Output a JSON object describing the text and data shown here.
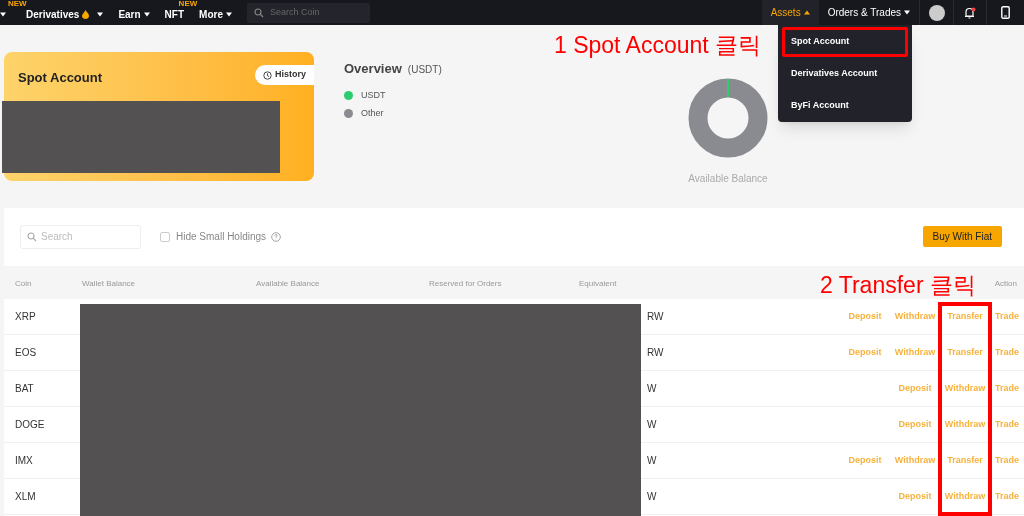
{
  "nav": {
    "items": [
      {
        "kind": "caret"
      },
      {
        "label": "Derivatives",
        "kind": "fire",
        "badge": "NEW"
      },
      {
        "label": "Earn",
        "kind": "menu"
      },
      {
        "label": "NFT",
        "kind": "plain",
        "badge": "NEW"
      },
      {
        "label": "More",
        "kind": "menu"
      }
    ],
    "search": {
      "placeholder": "Search Coin"
    },
    "right_items": [
      {
        "label": "Assets",
        "selected": true
      },
      {
        "label": "Orders & Trades",
        "selected": false
      }
    ]
  },
  "assets_menu": {
    "items": [
      {
        "label": "Spot Account",
        "annotated": true
      },
      {
        "label": "Derivatives Account",
        "annotated": false
      },
      {
        "label": "ByFi Account",
        "annotated": false
      }
    ]
  },
  "annotations": [
    "1 Spot Account 클릭",
    "2 Transfer 클릭"
  ],
  "account_card": {
    "title": "Spot Account",
    "history_button": "History"
  },
  "overview": {
    "title": "Overview",
    "unit": "(USDT)",
    "legend": [
      {
        "label": "USDT",
        "color": "#2ecc71"
      },
      {
        "label": "Other",
        "color": "#8a8b90"
      }
    ],
    "caption": "Available Balance"
  },
  "toolbar": {
    "search_placeholder": "Search",
    "hide_small": {
      "label": "Hide Small Holdings",
      "checked": false
    },
    "buy_button": "Buy With Fiat"
  },
  "table": {
    "columns": [
      "Coin",
      "Wallet Balance",
      "Available Balance",
      "Reserved for Orders",
      "Equivalent",
      "Action"
    ],
    "rows": [
      {
        "coin": "XRP",
        "equivalent": "RW",
        "actions": [
          "Deposit",
          "Withdraw",
          "Transfer",
          "Trade"
        ]
      },
      {
        "coin": "EOS",
        "equivalent": "RW",
        "actions": [
          "Deposit",
          "Withdraw",
          "Transfer",
          "Trade"
        ]
      },
      {
        "coin": "BAT",
        "equivalent": "W",
        "actions": [
          "Deposit",
          "Withdraw",
          "Trade"
        ]
      },
      {
        "coin": "DOGE",
        "equivalent": "W",
        "actions": [
          "Deposit",
          "Withdraw",
          "Trade"
        ]
      },
      {
        "coin": "IMX",
        "equivalent": "W",
        "actions": [
          "Deposit",
          "Withdraw",
          "Transfer",
          "Trade"
        ]
      },
      {
        "coin": "XLM",
        "equivalent": "W",
        "actions": [
          "Deposit",
          "Withdraw",
          "Trade"
        ]
      }
    ]
  }
}
